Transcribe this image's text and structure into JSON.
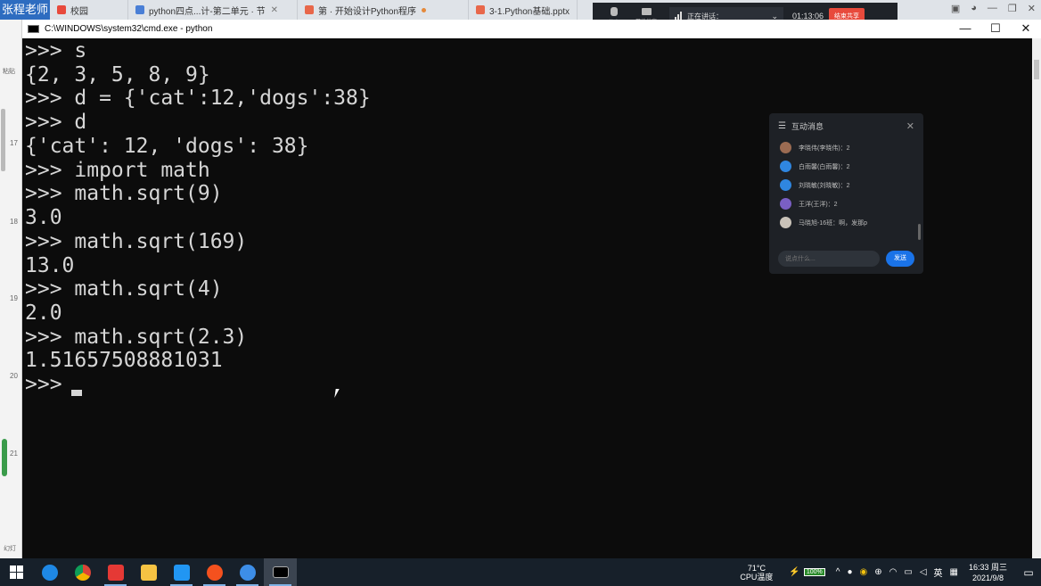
{
  "tabbar": {
    "brand": "张程老师",
    "tabs": [
      {
        "label": "校园",
        "color": "#e84a3c"
      },
      {
        "label": "python四点...计-第二单元 · 节",
        "color": "#4a7fd6"
      },
      {
        "label": "第 · 开始设计Python程序",
        "color": "#e8674a"
      },
      {
        "label": "3-1.Python基础.pptx",
        "color": "#e8674a"
      }
    ]
  },
  "meeting": {
    "mute_label": "静音",
    "share_label": "开始共享",
    "speaker_label": "正在讲话：",
    "timer": "01:13:06",
    "end_label": "结束共享"
  },
  "cmd": {
    "title": "C:\\WINDOWS\\system32\\cmd.exe - python",
    "lines": [
      ">>> s",
      "{2, 3, 5, 8, 9}",
      ">>> d = {'cat':12,'dogs':38}",
      ">>> d",
      "{'cat': 12, 'dogs': 38}",
      ">>> import math",
      ">>> math.sqrt(9)",
      "3.0",
      ">>> math.sqrt(169)",
      "13.0",
      ">>> math.sqrt(4)",
      "2.0",
      ">>> math.sqrt(2.3)",
      "1.51657508881031",
      ">>> "
    ]
  },
  "chat": {
    "title": "互动消息",
    "messages": [
      {
        "text": "李晓伟(李晓伟)：2",
        "color": "#9b6b52"
      },
      {
        "text": "白雨馨(白雨馨)：2",
        "color": "#2f86e0"
      },
      {
        "text": "刘晓敏(刘晓敏)：2",
        "color": "#2f86e0"
      },
      {
        "text": "王洋(王洋)：2",
        "color": "#7a5fc4"
      },
      {
        "text": "马晓旭-16班：啊，发那p",
        "color": "#c9c2b8"
      }
    ],
    "placeholder": "说点什么...",
    "send": "发送"
  },
  "sidebar": {
    "numbers": [
      "17",
      "18",
      "19",
      "20",
      "21"
    ],
    "top_label": "粘贴",
    "bottom_label": "幻灯"
  },
  "taskbar": {
    "temp": "71°C",
    "cpu_label": "CPU温度",
    "battery": "100%",
    "ime": "英",
    "time": "16:33 周三",
    "date": "2021/9/8"
  }
}
